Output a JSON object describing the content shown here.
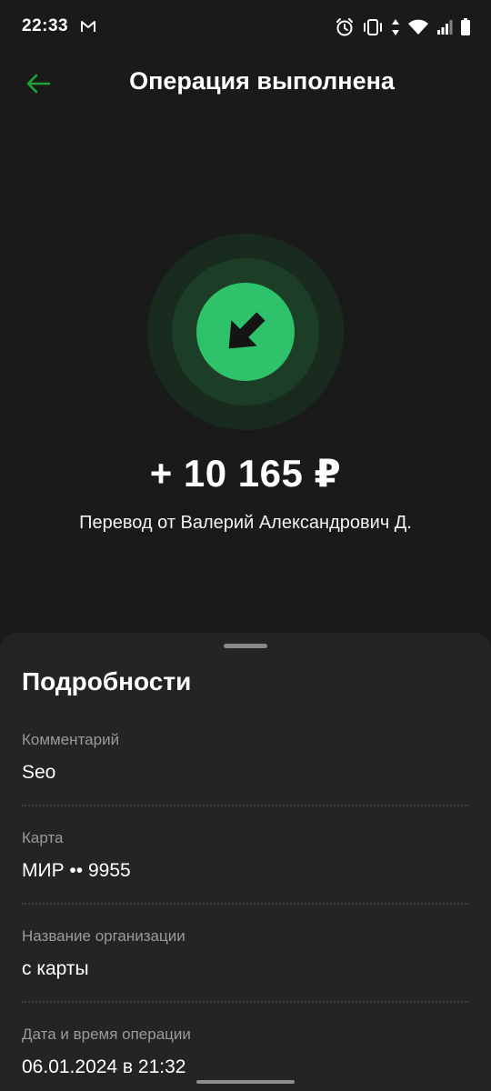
{
  "status_bar": {
    "time": "22:33"
  },
  "header": {
    "title": "Операция выполнена"
  },
  "operation": {
    "amount": "+ 10 165 ₽",
    "description": "Перевод от Валерий Александрович Д."
  },
  "details": {
    "title": "Подробности",
    "items": [
      {
        "label": "Комментарий",
        "value": "Seo"
      },
      {
        "label": "Карта",
        "value": "МИР •• 9955"
      },
      {
        "label": "Название организации",
        "value": "с карты"
      },
      {
        "label": "Дата и время операции",
        "value": "06.01.2024 в 21:32"
      }
    ]
  },
  "colors": {
    "background": "#1a1a1a",
    "sheet": "#242424",
    "accent_green": "#21a038",
    "icon_green": "#2ec26a"
  },
  "icons": {
    "back": "arrow-left-icon",
    "operation": "incoming-arrow-icon"
  }
}
